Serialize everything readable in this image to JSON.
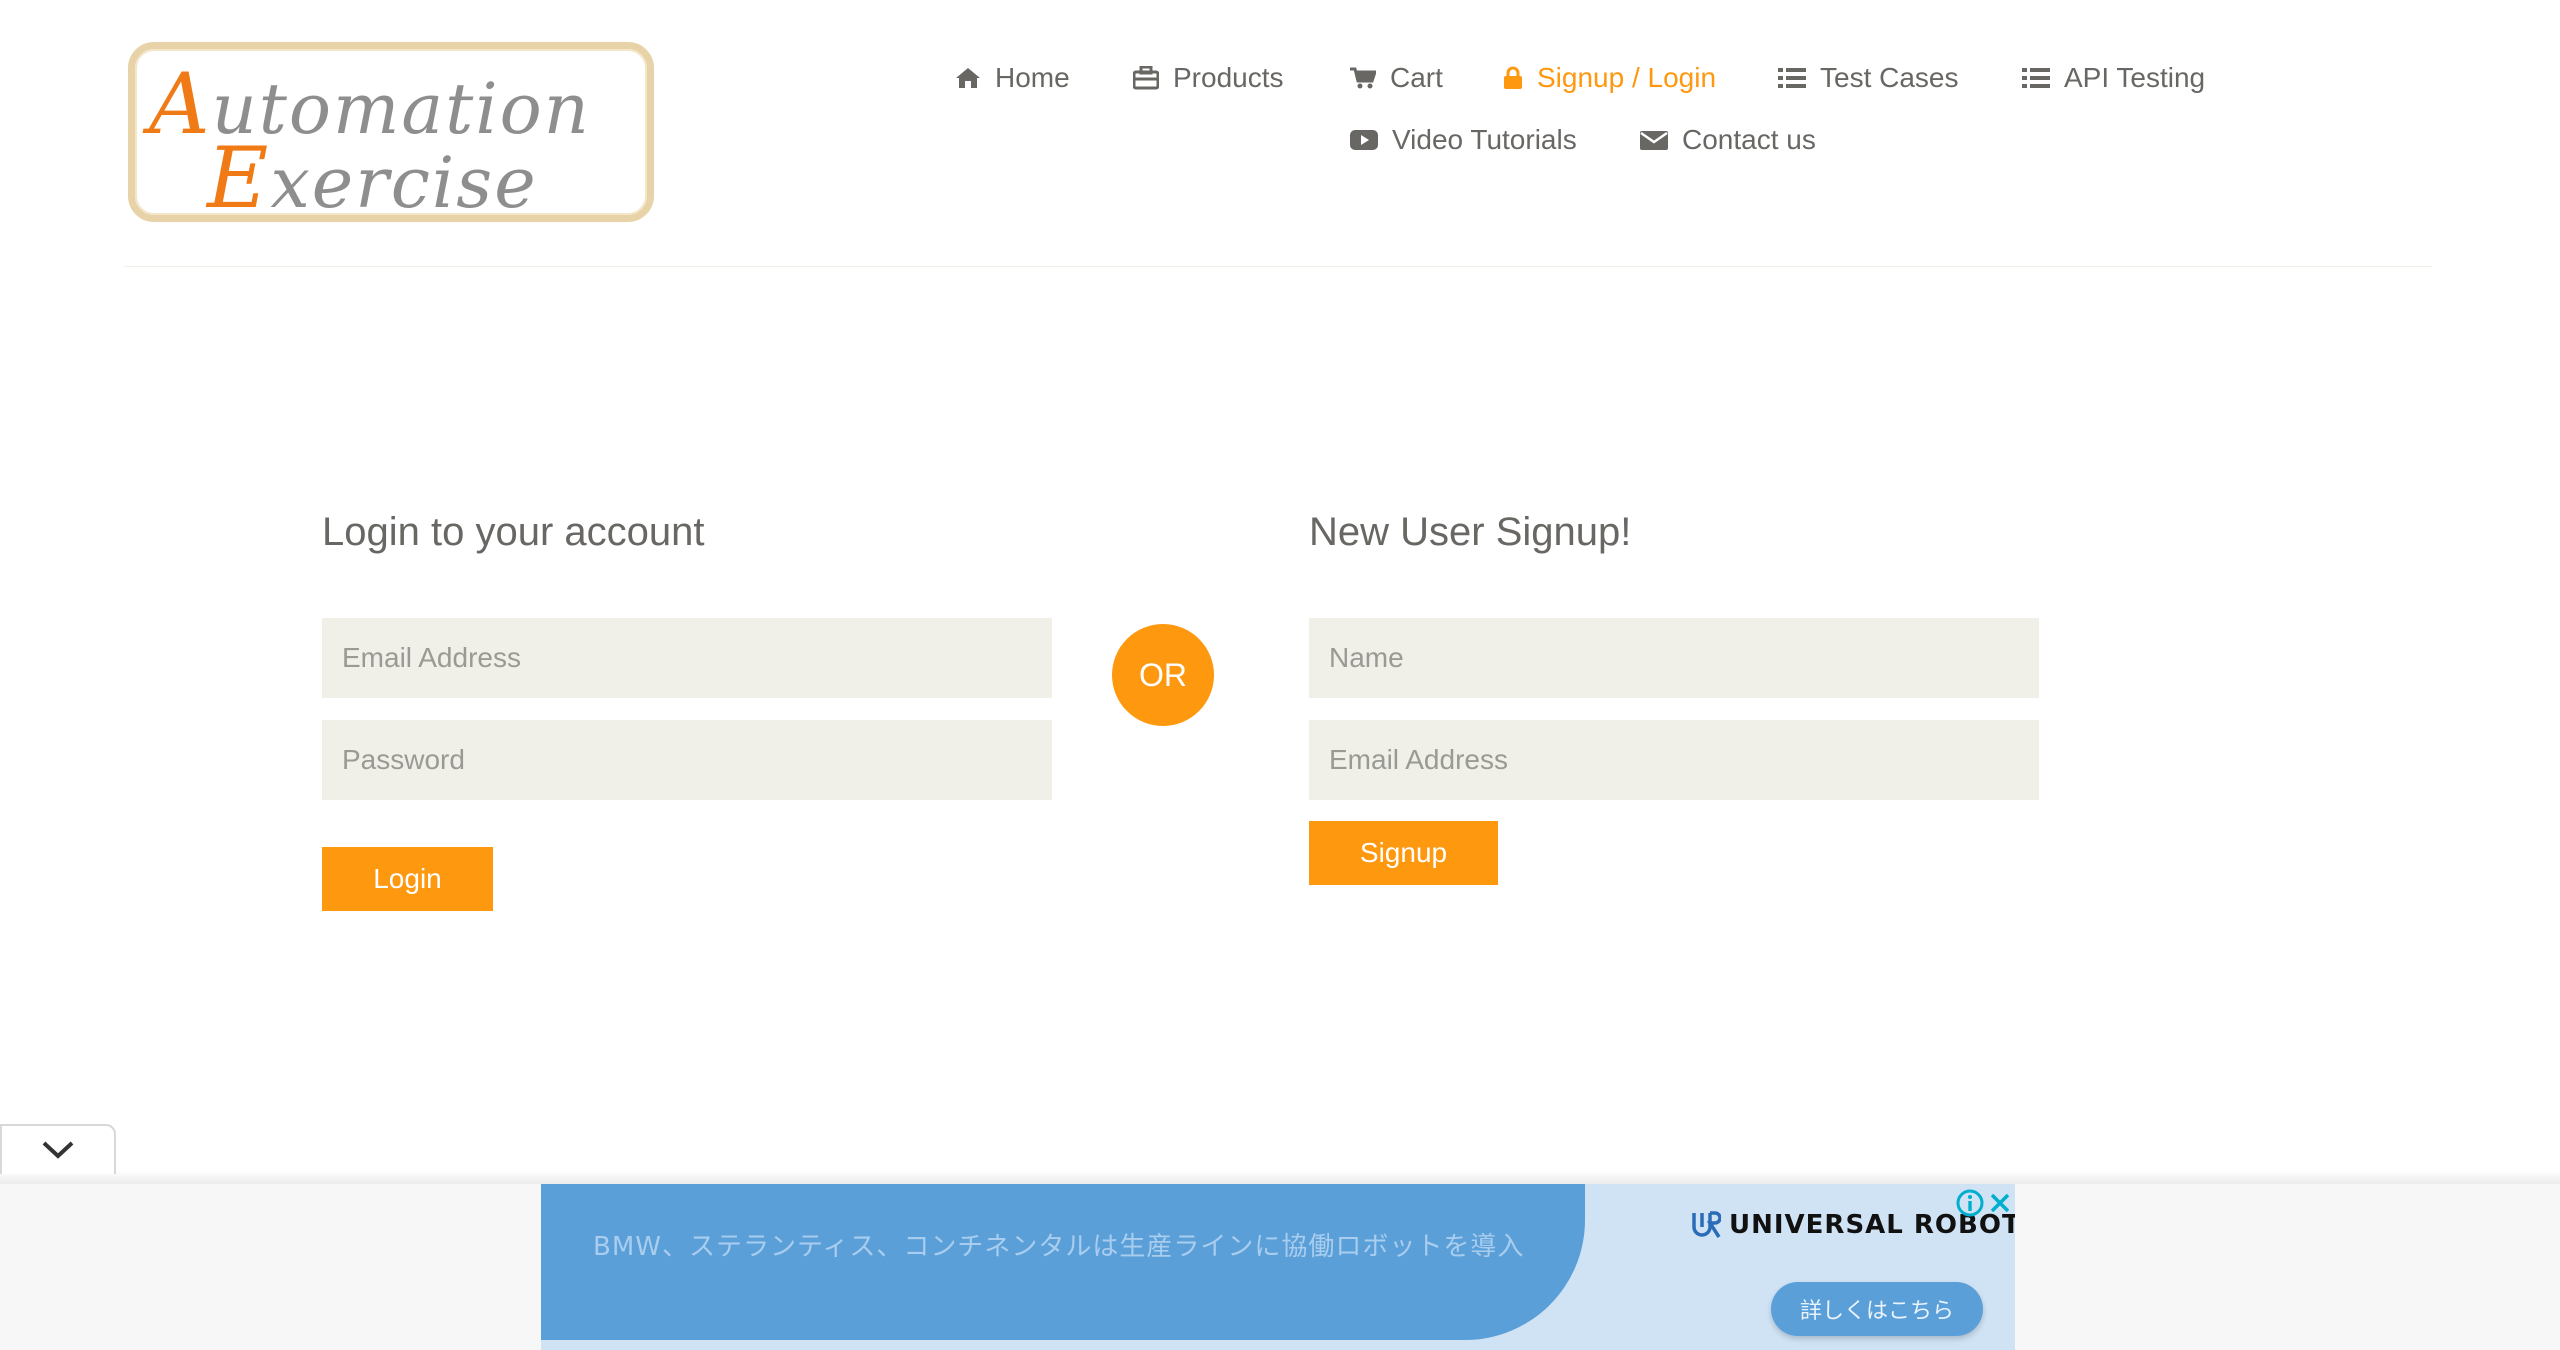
{
  "logo": {
    "line1_cap": "A",
    "line1_rest": "utomation",
    "line2_cap": "E",
    "line2_rest": "xercise"
  },
  "nav": [
    {
      "label": "Home",
      "icon": "home-icon"
    },
    {
      "label": "Products",
      "icon": "briefcase-icon"
    },
    {
      "label": "Cart",
      "icon": "cart-icon"
    },
    {
      "label": "Signup / Login",
      "icon": "lock-icon",
      "active": true
    },
    {
      "label": "Test Cases",
      "icon": "list-icon"
    },
    {
      "label": "API Testing",
      "icon": "list-icon"
    },
    {
      "label": "Video Tutorials",
      "icon": "youtube-play-icon"
    },
    {
      "label": "Contact us",
      "icon": "envelope-icon"
    }
  ],
  "login": {
    "title": "Login to your account",
    "email_placeholder": "Email Address",
    "password_placeholder": "Password",
    "button": "Login"
  },
  "or_label": "OR",
  "signup": {
    "title": "New User Signup!",
    "name_placeholder": "Name",
    "email_placeholder": "Email Address",
    "button": "Signup"
  },
  "ad": {
    "headline": "BMW、ステランティス、コンチネンタルは生産ラインに協働ロボットを導入",
    "brand": "UNIVERSAL ROBOTS",
    "cta": "詳しくはこちら"
  },
  "colors": {
    "accent": "#fe980f",
    "text": "#696763",
    "input_bg": "#f0f0e9"
  }
}
